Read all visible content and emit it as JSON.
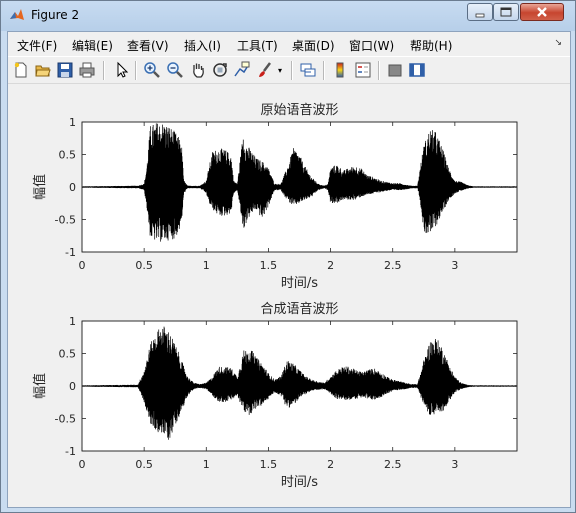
{
  "window": {
    "title": "Figure 2"
  },
  "menus": [
    {
      "label": "文件(F)"
    },
    {
      "label": "编辑(E)"
    },
    {
      "label": "查看(V)"
    },
    {
      "label": "插入(I)"
    },
    {
      "label": "工具(T)"
    },
    {
      "label": "桌面(D)"
    },
    {
      "label": "窗口(W)"
    },
    {
      "label": "帮助(H)"
    }
  ],
  "toolbar": {
    "icons": [
      "new-figure-icon",
      "open-folder-icon",
      "save-icon",
      "print-icon",
      "select-arrow-icon",
      "zoom-in-icon",
      "zoom-out-icon",
      "pan-hand-icon",
      "rotate-3d-icon",
      "data-cursor-icon",
      "brush-icon",
      "link-icon",
      "colorbar-icon",
      "legend-icon",
      "hide-plot-tools-icon",
      "show-plot-tools-icon"
    ]
  },
  "chart_data": [
    {
      "type": "line",
      "title": "原始语音波形",
      "xlabel": "时间/s",
      "ylabel": "幅值",
      "xlim": [
        0,
        3.5
      ],
      "ylim": [
        -1,
        1
      ],
      "xticks": [
        "0",
        "0.5",
        "1",
        "1.5",
        "2",
        "2.5",
        "3"
      ],
      "yticks": [
        "-1",
        "-0.5",
        "0",
        "0.5",
        "1"
      ],
      "envelope": {
        "t": [
          0,
          0.45,
          0.5,
          0.52,
          0.55,
          0.6,
          0.65,
          0.7,
          0.75,
          0.8,
          0.82,
          0.85,
          0.95,
          1.0,
          1.02,
          1.05,
          1.1,
          1.15,
          1.2,
          1.22,
          1.25,
          1.3,
          1.31,
          1.35,
          1.4,
          1.45,
          1.5,
          1.55,
          1.6,
          1.65,
          1.7,
          1.72,
          1.75,
          1.8,
          1.85,
          1.9,
          1.95,
          1.98,
          2.0,
          2.05,
          2.08,
          2.1,
          2.15,
          2.2,
          2.25,
          2.3,
          2.35,
          2.4,
          2.45,
          2.5,
          2.55,
          2.6,
          2.65,
          2.7,
          2.72,
          2.75,
          2.8,
          2.85,
          2.9,
          2.95,
          3.0,
          3.05,
          3.1,
          3.15,
          3.5
        ],
        "upper": [
          0.01,
          0.02,
          0.05,
          0.3,
          0.95,
          1.0,
          1.0,
          0.95,
          0.85,
          0.7,
          0.1,
          0.02,
          0.02,
          0.1,
          0.3,
          0.55,
          0.6,
          0.58,
          0.5,
          0.1,
          0.05,
          0.9,
          0.7,
          0.6,
          0.45,
          0.4,
          0.3,
          0.05,
          0.05,
          0.3,
          0.6,
          0.58,
          0.5,
          0.3,
          0.15,
          0.05,
          0.02,
          0.05,
          0.3,
          0.35,
          0.3,
          0.25,
          0.3,
          0.33,
          0.28,
          0.18,
          0.15,
          0.1,
          0.08,
          0.06,
          0.06,
          0.04,
          0.02,
          0.02,
          0.3,
          0.65,
          0.9,
          0.85,
          0.6,
          0.3,
          0.1,
          0.08,
          0.03,
          0.01,
          0.01
        ],
        "lower": [
          -0.01,
          -0.02,
          -0.05,
          -0.3,
          -0.8,
          -0.85,
          -0.85,
          -0.82,
          -0.8,
          -0.6,
          -0.1,
          -0.02,
          -0.02,
          -0.1,
          -0.25,
          -0.35,
          -0.45,
          -0.45,
          -0.4,
          -0.1,
          -0.05,
          -0.7,
          -0.6,
          -0.45,
          -0.35,
          -0.5,
          -0.3,
          -0.05,
          -0.05,
          -0.2,
          -0.3,
          -0.28,
          -0.25,
          -0.2,
          -0.15,
          -0.05,
          -0.02,
          -0.05,
          -0.25,
          -0.25,
          -0.22,
          -0.2,
          -0.2,
          -0.2,
          -0.15,
          -0.12,
          -0.1,
          -0.08,
          -0.06,
          -0.05,
          -0.05,
          -0.04,
          -0.02,
          -0.02,
          -0.2,
          -0.7,
          -0.75,
          -0.6,
          -0.4,
          -0.2,
          -0.1,
          -0.06,
          -0.03,
          -0.01,
          -0.01
        ]
      }
    },
    {
      "type": "line",
      "title": "合成语音波形",
      "xlabel": "时间/s",
      "ylabel": "幅值",
      "xlim": [
        0,
        3.5
      ],
      "ylim": [
        -1,
        1
      ],
      "xticks": [
        "0",
        "0.5",
        "1",
        "1.5",
        "2",
        "2.5",
        "3"
      ],
      "yticks": [
        "-1",
        "-0.5",
        "0",
        "0.5",
        "1"
      ],
      "envelope": {
        "t": [
          0,
          0.45,
          0.5,
          0.55,
          0.6,
          0.65,
          0.7,
          0.75,
          0.8,
          0.85,
          0.9,
          0.95,
          1.0,
          1.05,
          1.1,
          1.15,
          1.2,
          1.25,
          1.3,
          1.35,
          1.4,
          1.45,
          1.5,
          1.55,
          1.6,
          1.65,
          1.7,
          1.75,
          1.8,
          1.85,
          1.9,
          1.95,
          2.0,
          2.05,
          2.1,
          2.15,
          2.2,
          2.25,
          2.3,
          2.35,
          2.4,
          2.45,
          2.5,
          2.55,
          2.6,
          2.65,
          2.7,
          2.75,
          2.8,
          2.85,
          2.9,
          2.95,
          3.0,
          3.05,
          3.1,
          3.15,
          3.5
        ],
        "upper": [
          0.01,
          0.02,
          0.25,
          0.65,
          0.85,
          0.95,
          0.85,
          0.65,
          0.4,
          0.15,
          0.05,
          0.03,
          0.05,
          0.15,
          0.3,
          0.3,
          0.28,
          0.15,
          0.55,
          0.6,
          0.45,
          0.35,
          0.2,
          0.1,
          0.15,
          0.4,
          0.35,
          0.25,
          0.15,
          0.1,
          0.07,
          0.05,
          0.15,
          0.25,
          0.3,
          0.3,
          0.25,
          0.22,
          0.25,
          0.28,
          0.22,
          0.15,
          0.1,
          0.08,
          0.05,
          0.03,
          0.03,
          0.4,
          0.7,
          0.75,
          0.6,
          0.35,
          0.15,
          0.05,
          0.02,
          0.01,
          0.01
        ],
        "lower": [
          -0.01,
          -0.02,
          -0.25,
          -0.6,
          -0.7,
          -0.75,
          -0.85,
          -0.6,
          -0.4,
          -0.15,
          -0.05,
          -0.03,
          -0.05,
          -0.15,
          -0.25,
          -0.25,
          -0.22,
          -0.15,
          -0.4,
          -0.45,
          -0.35,
          -0.3,
          -0.2,
          -0.1,
          -0.15,
          -0.35,
          -0.3,
          -0.2,
          -0.12,
          -0.08,
          -0.06,
          -0.05,
          -0.12,
          -0.2,
          -0.22,
          -0.22,
          -0.2,
          -0.18,
          -0.2,
          -0.22,
          -0.18,
          -0.12,
          -0.08,
          -0.06,
          -0.05,
          -0.03,
          -0.03,
          -0.3,
          -0.45,
          -0.45,
          -0.4,
          -0.25,
          -0.1,
          -0.05,
          -0.02,
          -0.01,
          -0.01
        ]
      }
    }
  ]
}
